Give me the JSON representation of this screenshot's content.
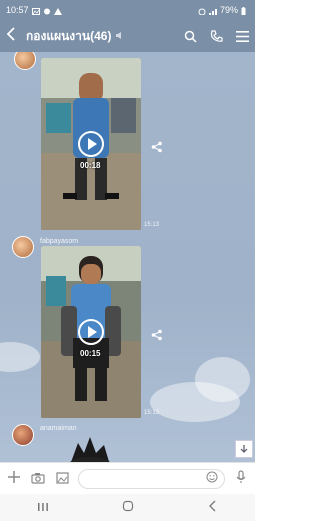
{
  "status": {
    "time": "10:57",
    "battery": "79%"
  },
  "header": {
    "title": "กองแผนงาน(46)",
    "mute_glyph": "🔇"
  },
  "messages": [
    {
      "sender": "",
      "duration": "00:18",
      "timestamp": "15:13"
    },
    {
      "sender": "fabpayasom",
      "duration": "00:15",
      "timestamp": "15:13"
    },
    {
      "sender": "anamaiman"
    }
  ],
  "icons": {
    "back": "back-icon",
    "search": "search-icon",
    "call": "phone-icon",
    "menu": "menu-icon",
    "share": "share-icon",
    "play": "play-icon",
    "scroll": "scroll-down-icon",
    "add": "plus-icon",
    "camera": "camera-icon",
    "gallery": "image-icon",
    "emoji": "emoji-icon",
    "mic": "microphone-icon"
  },
  "colors": {
    "header_bg": "#7b8fa6",
    "chat_bg": "#a3b5cb"
  }
}
